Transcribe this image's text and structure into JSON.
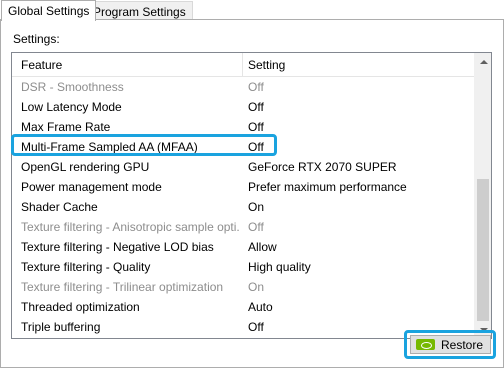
{
  "tabs": [
    {
      "label": "Global Settings",
      "active": true
    },
    {
      "label": "Program Settings",
      "active": false
    }
  ],
  "settings_label": "Settings:",
  "table": {
    "columns": [
      "Feature",
      "Setting"
    ],
    "rows": [
      {
        "feature": "DSR - Smoothness",
        "setting": "Off",
        "disabled": true
      },
      {
        "feature": "Low Latency Mode",
        "setting": "Off",
        "disabled": false
      },
      {
        "feature": "Max Frame Rate",
        "setting": "Off",
        "disabled": false,
        "highlighted": true
      },
      {
        "feature": "Multi-Frame Sampled AA (MFAA)",
        "setting": "Off",
        "disabled": false
      },
      {
        "feature": "OpenGL rendering GPU",
        "setting": "GeForce RTX 2070 SUPER",
        "disabled": false
      },
      {
        "feature": "Power management mode",
        "setting": "Prefer maximum performance",
        "disabled": false
      },
      {
        "feature": "Shader Cache",
        "setting": "On",
        "disabled": false
      },
      {
        "feature": "Texture filtering - Anisotropic sample opti...",
        "setting": "Off",
        "disabled": true
      },
      {
        "feature": "Texture filtering - Negative LOD bias",
        "setting": "Allow",
        "disabled": false
      },
      {
        "feature": "Texture filtering - Quality",
        "setting": "High quality",
        "disabled": false
      },
      {
        "feature": "Texture filtering - Trilinear optimization",
        "setting": "On",
        "disabled": true
      },
      {
        "feature": "Threaded optimization",
        "setting": "Auto",
        "disabled": false
      },
      {
        "feature": "Triple buffering",
        "setting": "Off",
        "disabled": false
      }
    ]
  },
  "restore_button": {
    "label": "Restore",
    "icon": "nvidia-logo-icon"
  },
  "colors": {
    "highlight": "#1aa3df",
    "disabled_text": "#8d8d8d",
    "nvidia_green": "#76b900"
  }
}
